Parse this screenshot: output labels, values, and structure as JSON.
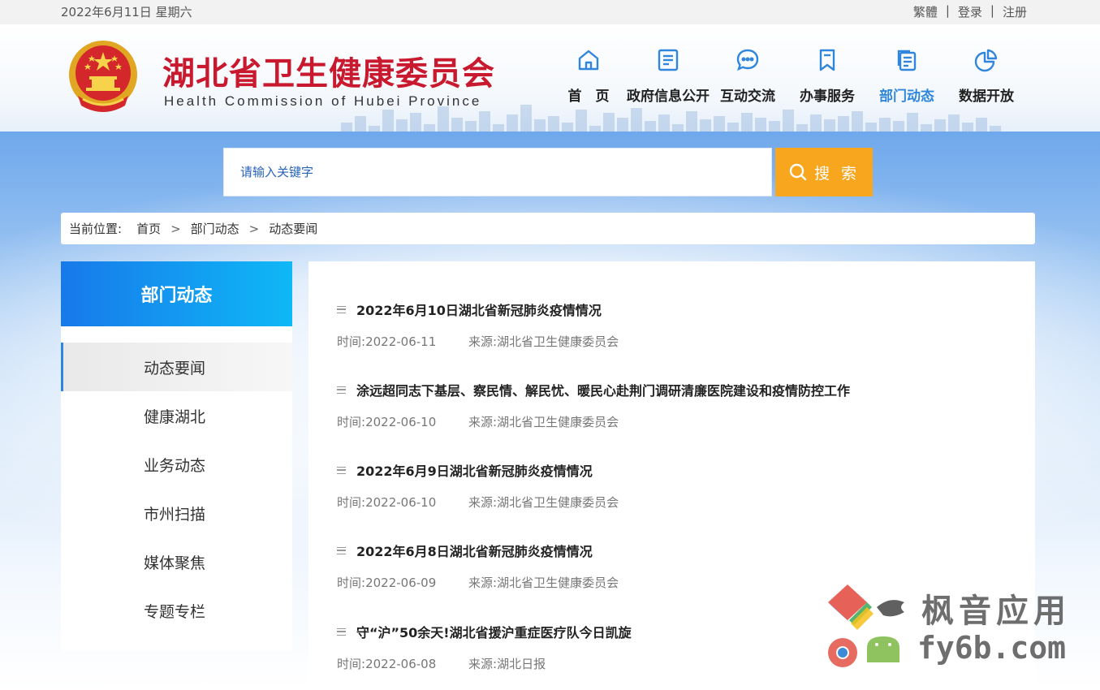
{
  "topbar": {
    "date": "2022年6月11日 星期六",
    "traditional": "繁體",
    "login": "登录",
    "register": "注册",
    "separator": "|"
  },
  "header": {
    "title": "湖北省卫生健康委员会",
    "subtitle": "Health Commission of Hubei Province",
    "nav": [
      {
        "label": "首　页",
        "icon": "home-icon"
      },
      {
        "label": "政府信息公开",
        "icon": "document-list-icon"
      },
      {
        "label": "互动交流",
        "icon": "chat-bubble-icon"
      },
      {
        "label": "办事服务",
        "icon": "bookmark-icon"
      },
      {
        "label": "部门动态",
        "icon": "files-icon",
        "active": true
      },
      {
        "label": "数据开放",
        "icon": "pie-chart-icon"
      }
    ]
  },
  "search": {
    "placeholder": "请输入关键字",
    "button_label": "搜 索"
  },
  "breadcrumb": {
    "prefix": "当前位置:",
    "items": [
      "首页",
      "部门动态",
      "动态要闻"
    ],
    "separator": ">"
  },
  "sidebar": {
    "heading": "部门动态",
    "items": [
      "动态要闻",
      "健康湖北",
      "业务动态",
      "市州扫描",
      "媒体聚焦",
      "专题专栏"
    ],
    "active_index": 0
  },
  "news": {
    "time_label": "时间:",
    "source_label": "来源:",
    "items": [
      {
        "title": "2022年6月10日湖北省新冠肺炎疫情情况",
        "date": "2022-06-11",
        "source": "湖北省卫生健康委员会"
      },
      {
        "title": "涂远超同志下基层、察民情、解民忧、暖民心赴荆门调研清廉医院建设和疫情防控工作",
        "date": "2022-06-10",
        "source": "湖北省卫生健康委员会"
      },
      {
        "title": "2022年6月9日湖北省新冠肺炎疫情情况",
        "date": "2022-06-10",
        "source": "湖北省卫生健康委员会"
      },
      {
        "title": "2022年6月8日湖北省新冠肺炎疫情情况",
        "date": "2022-06-09",
        "source": "湖北省卫生健康委员会"
      },
      {
        "title": "守“沪”50余天!湖北省援沪重症医疗队今日凯旋",
        "date": "2022-06-08",
        "source": "湖北日报"
      }
    ]
  },
  "watermark": {
    "line1": "枫音应用",
    "line2": "fy6b.com"
  },
  "colors": {
    "title_red": "#c8192e",
    "accent_blue": "#2f86dc",
    "search_orange": "#f7a61e"
  }
}
